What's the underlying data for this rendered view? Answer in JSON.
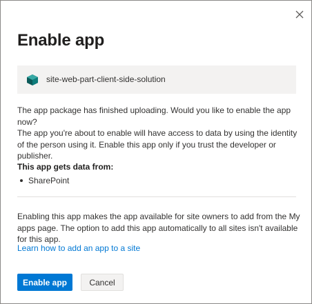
{
  "dialog": {
    "title": "Enable app",
    "close_icon": "close-icon"
  },
  "package": {
    "icon": "package-cube-icon",
    "name": "site-web-part-client-side-solution"
  },
  "body": {
    "upload_message": "The app package has finished uploading. Would you like to enable the app now?",
    "access_message": "The app you're about to enable will have access to data by using the identity of the person using it. Enable this app only if you trust the developer or publisher.",
    "data_heading": "This app gets data from:",
    "data_sources": [
      "SharePoint"
    ],
    "availability_message": "Enabling this app makes the app available for site owners to add from the My apps page. The option to add this app automatically to all sites isn't available for this app.",
    "learn_link": "Learn how to add an app to a site"
  },
  "buttons": {
    "enable_label": "Enable app",
    "cancel_label": "Cancel"
  },
  "colors": {
    "accent": "#0078d4",
    "icon_teal": "#0e7c7b"
  }
}
